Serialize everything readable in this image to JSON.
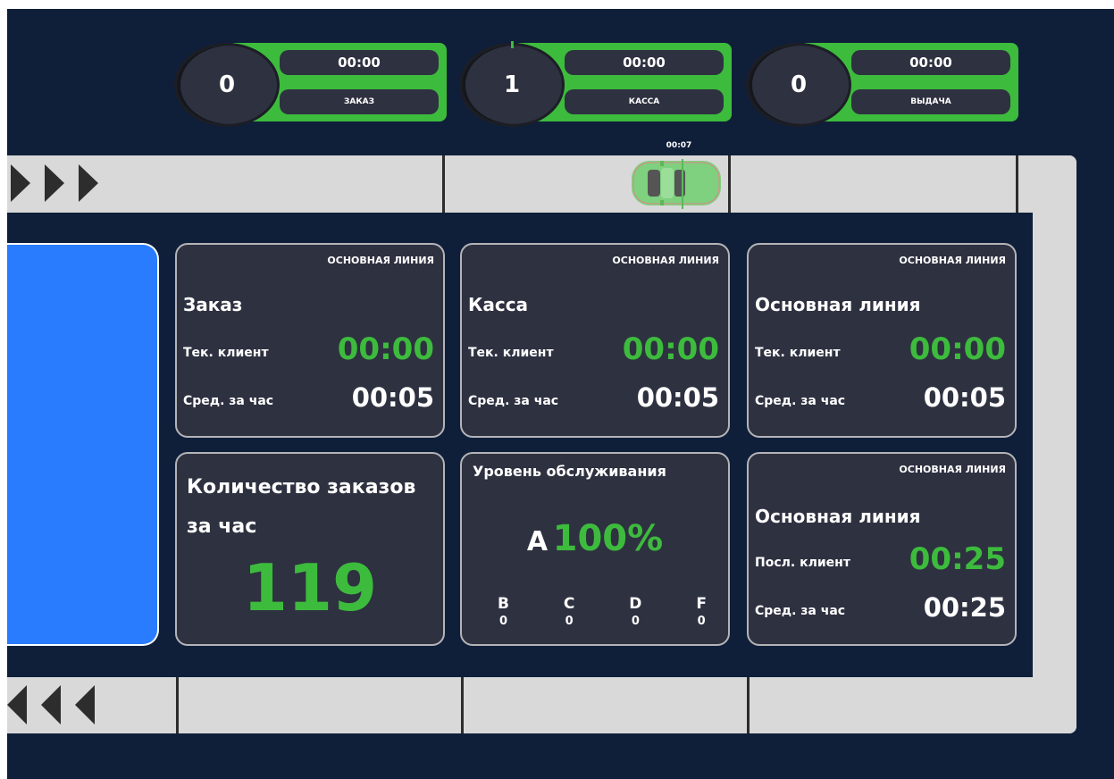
{
  "counters": [
    {
      "count": "0",
      "time": "00:00",
      "label": "ЗАКАЗ"
    },
    {
      "count": "1",
      "time": "00:00",
      "label": "КАССА"
    },
    {
      "count": "0",
      "time": "00:00",
      "label": "ВЫДАЧА"
    }
  ],
  "car": {
    "timer": "00:07",
    "icon": "car-icon"
  },
  "lanes": {
    "top_arrows_icon": "chevron-right-icon",
    "bottom_arrows_icon": "chevron-left-icon"
  },
  "stations": [
    {
      "tag": "ОСНОВНАЯ ЛИНИЯ",
      "title": "Заказ",
      "current_label": "Тек. клиент",
      "current_value": "00:00",
      "avg_label": "Сред. за час",
      "avg_value": "00:05"
    },
    {
      "tag": "ОСНОВНАЯ ЛИНИЯ",
      "title": "Касса",
      "current_label": "Тек. клиент",
      "current_value": "00:00",
      "avg_label": "Сред. за час",
      "avg_value": "00:05"
    },
    {
      "tag": "ОСНОВНАЯ ЛИНИЯ",
      "title": "Основная линия",
      "current_label": "Тек. клиент",
      "current_value": "00:00",
      "avg_label": "Сред. за час",
      "avg_value": "00:05"
    }
  ],
  "orders": {
    "title": "Количество заказов за час",
    "value": "119"
  },
  "service": {
    "title": "Уровень обслуживания",
    "grade": "A",
    "percent": "100%",
    "grades": [
      {
        "letter": "B",
        "value": "0"
      },
      {
        "letter": "C",
        "value": "0"
      },
      {
        "letter": "D",
        "value": "0"
      },
      {
        "letter": "F",
        "value": "0"
      }
    ]
  },
  "last_client": {
    "tag": "ОСНОВНАЯ ЛИНИЯ",
    "title": "Основная линия",
    "last_label": "Посл. клиент",
    "last_value": "00:25",
    "avg_label": "Сред. за час",
    "avg_value": "00:25"
  },
  "colors": {
    "background": "#0f1f3a",
    "accent_green": "#3dbb3d",
    "card": "#2e3140",
    "lane": "#d9d9d9",
    "panel_blue": "#2a7cff"
  }
}
